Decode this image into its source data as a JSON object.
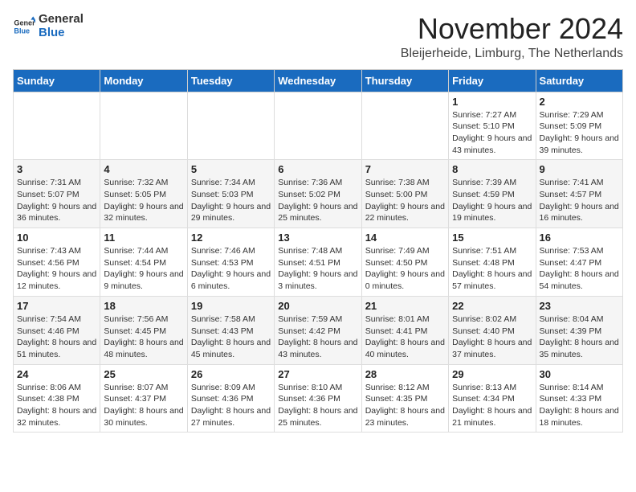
{
  "logo": {
    "general": "General",
    "blue": "Blue"
  },
  "title": "November 2024",
  "location": "Bleijerheide, Limburg, The Netherlands",
  "weekdays": [
    "Sunday",
    "Monday",
    "Tuesday",
    "Wednesday",
    "Thursday",
    "Friday",
    "Saturday"
  ],
  "weeks": [
    [
      {
        "day": "",
        "info": ""
      },
      {
        "day": "",
        "info": ""
      },
      {
        "day": "",
        "info": ""
      },
      {
        "day": "",
        "info": ""
      },
      {
        "day": "",
        "info": ""
      },
      {
        "day": "1",
        "info": "Sunrise: 7:27 AM\nSunset: 5:10 PM\nDaylight: 9 hours and 43 minutes."
      },
      {
        "day": "2",
        "info": "Sunrise: 7:29 AM\nSunset: 5:09 PM\nDaylight: 9 hours and 39 minutes."
      }
    ],
    [
      {
        "day": "3",
        "info": "Sunrise: 7:31 AM\nSunset: 5:07 PM\nDaylight: 9 hours and 36 minutes."
      },
      {
        "day": "4",
        "info": "Sunrise: 7:32 AM\nSunset: 5:05 PM\nDaylight: 9 hours and 32 minutes."
      },
      {
        "day": "5",
        "info": "Sunrise: 7:34 AM\nSunset: 5:03 PM\nDaylight: 9 hours and 29 minutes."
      },
      {
        "day": "6",
        "info": "Sunrise: 7:36 AM\nSunset: 5:02 PM\nDaylight: 9 hours and 25 minutes."
      },
      {
        "day": "7",
        "info": "Sunrise: 7:38 AM\nSunset: 5:00 PM\nDaylight: 9 hours and 22 minutes."
      },
      {
        "day": "8",
        "info": "Sunrise: 7:39 AM\nSunset: 4:59 PM\nDaylight: 9 hours and 19 minutes."
      },
      {
        "day": "9",
        "info": "Sunrise: 7:41 AM\nSunset: 4:57 PM\nDaylight: 9 hours and 16 minutes."
      }
    ],
    [
      {
        "day": "10",
        "info": "Sunrise: 7:43 AM\nSunset: 4:56 PM\nDaylight: 9 hours and 12 minutes."
      },
      {
        "day": "11",
        "info": "Sunrise: 7:44 AM\nSunset: 4:54 PM\nDaylight: 9 hours and 9 minutes."
      },
      {
        "day": "12",
        "info": "Sunrise: 7:46 AM\nSunset: 4:53 PM\nDaylight: 9 hours and 6 minutes."
      },
      {
        "day": "13",
        "info": "Sunrise: 7:48 AM\nSunset: 4:51 PM\nDaylight: 9 hours and 3 minutes."
      },
      {
        "day": "14",
        "info": "Sunrise: 7:49 AM\nSunset: 4:50 PM\nDaylight: 9 hours and 0 minutes."
      },
      {
        "day": "15",
        "info": "Sunrise: 7:51 AM\nSunset: 4:48 PM\nDaylight: 8 hours and 57 minutes."
      },
      {
        "day": "16",
        "info": "Sunrise: 7:53 AM\nSunset: 4:47 PM\nDaylight: 8 hours and 54 minutes."
      }
    ],
    [
      {
        "day": "17",
        "info": "Sunrise: 7:54 AM\nSunset: 4:46 PM\nDaylight: 8 hours and 51 minutes."
      },
      {
        "day": "18",
        "info": "Sunrise: 7:56 AM\nSunset: 4:45 PM\nDaylight: 8 hours and 48 minutes."
      },
      {
        "day": "19",
        "info": "Sunrise: 7:58 AM\nSunset: 4:43 PM\nDaylight: 8 hours and 45 minutes."
      },
      {
        "day": "20",
        "info": "Sunrise: 7:59 AM\nSunset: 4:42 PM\nDaylight: 8 hours and 43 minutes."
      },
      {
        "day": "21",
        "info": "Sunrise: 8:01 AM\nSunset: 4:41 PM\nDaylight: 8 hours and 40 minutes."
      },
      {
        "day": "22",
        "info": "Sunrise: 8:02 AM\nSunset: 4:40 PM\nDaylight: 8 hours and 37 minutes."
      },
      {
        "day": "23",
        "info": "Sunrise: 8:04 AM\nSunset: 4:39 PM\nDaylight: 8 hours and 35 minutes."
      }
    ],
    [
      {
        "day": "24",
        "info": "Sunrise: 8:06 AM\nSunset: 4:38 PM\nDaylight: 8 hours and 32 minutes."
      },
      {
        "day": "25",
        "info": "Sunrise: 8:07 AM\nSunset: 4:37 PM\nDaylight: 8 hours and 30 minutes."
      },
      {
        "day": "26",
        "info": "Sunrise: 8:09 AM\nSunset: 4:36 PM\nDaylight: 8 hours and 27 minutes."
      },
      {
        "day": "27",
        "info": "Sunrise: 8:10 AM\nSunset: 4:36 PM\nDaylight: 8 hours and 25 minutes."
      },
      {
        "day": "28",
        "info": "Sunrise: 8:12 AM\nSunset: 4:35 PM\nDaylight: 8 hours and 23 minutes."
      },
      {
        "day": "29",
        "info": "Sunrise: 8:13 AM\nSunset: 4:34 PM\nDaylight: 8 hours and 21 minutes."
      },
      {
        "day": "30",
        "info": "Sunrise: 8:14 AM\nSunset: 4:33 PM\nDaylight: 8 hours and 18 minutes."
      }
    ]
  ]
}
